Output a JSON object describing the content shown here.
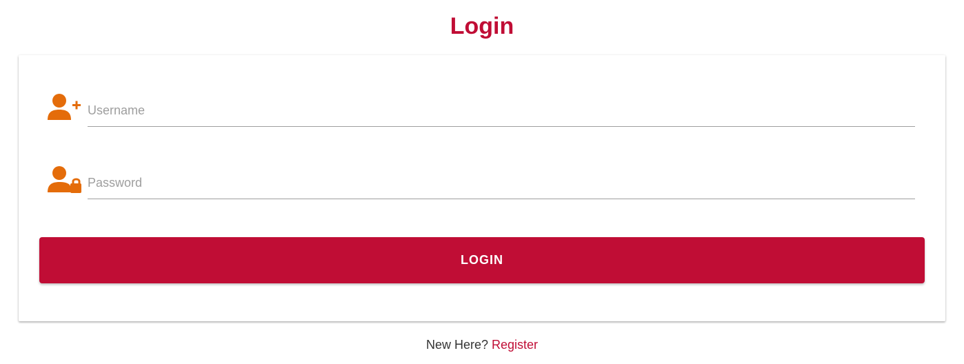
{
  "page": {
    "title": "Login"
  },
  "form": {
    "username": {
      "value": "",
      "placeholder": "Username",
      "icon": "add-user-icon"
    },
    "password": {
      "value": "",
      "placeholder": "Password",
      "icon": "user-lock-icon"
    },
    "submit_label": "LOGIN"
  },
  "footer": {
    "prompt": "New Here?",
    "link_label": "Register"
  },
  "colors": {
    "brand": "#c00d35",
    "icon": "#e46c0a",
    "underline": "#9e9e9e"
  }
}
